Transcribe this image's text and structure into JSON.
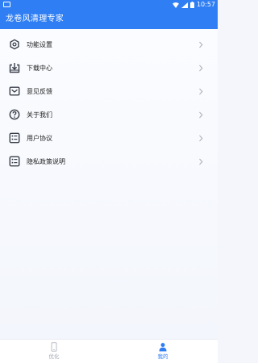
{
  "status_bar": {
    "time": "10:57",
    "icons": [
      "notification-square-icon",
      "wifi-icon",
      "signal-icon",
      "battery-icon"
    ]
  },
  "app_bar": {
    "title": "龙卷风清理专家"
  },
  "menu": {
    "items": [
      {
        "label": "功能设置",
        "icon": "settings-icon"
      },
      {
        "label": "下载中心",
        "icon": "download-icon"
      },
      {
        "label": "意见反馈",
        "icon": "feedback-icon"
      },
      {
        "label": "关于我们",
        "icon": "help-icon"
      },
      {
        "label": "用户协议",
        "icon": "document-list-icon"
      },
      {
        "label": "隐私政策说明",
        "icon": "privacy-list-icon"
      }
    ]
  },
  "bottom_nav": {
    "items": [
      {
        "label": "优化",
        "icon": "phone-icon",
        "active": false
      },
      {
        "label": "我的",
        "icon": "user-icon",
        "active": true
      }
    ]
  },
  "colors": {
    "accent": "#2f7ef3",
    "text": "#222222",
    "inactive": "#a2a7b2"
  }
}
